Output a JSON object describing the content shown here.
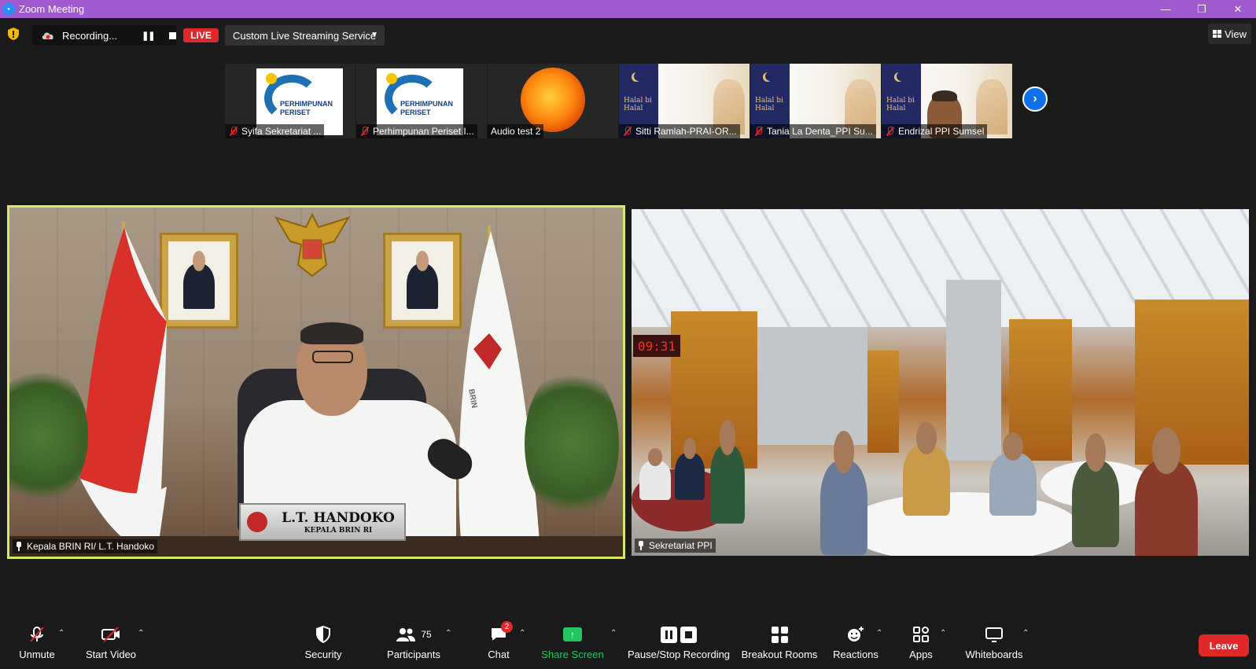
{
  "window": {
    "title": "Zoom Meeting",
    "app_icon": "zoom"
  },
  "topbar": {
    "security_icon": "shield-icon",
    "recording_label": "Recording...",
    "live_label": "LIVE",
    "stream_service": "Custom Live Streaming Service",
    "view_label": "View"
  },
  "thumbnails": [
    {
      "name": "Syifa Sekretariat ...",
      "muted": true,
      "content": "ppi-logo"
    },
    {
      "name": "Perhimpunan Periset I...",
      "muted": true,
      "content": "ppi-logo"
    },
    {
      "name": "Audio test 2",
      "muted": false,
      "content": "sun-image"
    },
    {
      "name": "Sitti Ramlah-PRAI-OR...",
      "muted": true,
      "content": "halal-bihalal"
    },
    {
      "name": "Tania La Denta_PPI Su...",
      "muted": true,
      "content": "halal-bihalal"
    },
    {
      "name": "Endrizal PPI Sumsel",
      "muted": true,
      "content": "halal-bihalal-person"
    }
  ],
  "logo_text": {
    "line1": "PERHIMPUNAN",
    "line2": "PERISET"
  },
  "halal_text": {
    "line1": "Halal bi",
    "line2": "Halal"
  },
  "main_videos": {
    "left": {
      "name": "Kepala BRIN RI/ L.T. Handoko",
      "nameplate_name": "L.T. HANDOKO",
      "nameplate_title": "KEPALA BRIN RI",
      "flag_text": "BRIN"
    },
    "right": {
      "name": "Sekretariat PPI",
      "clock": "09:31"
    }
  },
  "toolbar": {
    "unmute": "Unmute",
    "start_video": "Start Video",
    "security": "Security",
    "participants": "Participants",
    "participants_count": "75",
    "chat": "Chat",
    "chat_badge": "2",
    "share_screen": "Share Screen",
    "pause_stop_recording": "Pause/Stop Recording",
    "breakout_rooms": "Breakout Rooms",
    "reactions": "Reactions",
    "apps": "Apps",
    "whiteboards": "Whiteboards",
    "leave": "Leave"
  },
  "colors": {
    "titlebar": "#a05ad0",
    "live": "#e02828",
    "share": "#22c55e",
    "speaker_border": "#d6e86a",
    "accent_blue": "#0e71eb"
  }
}
